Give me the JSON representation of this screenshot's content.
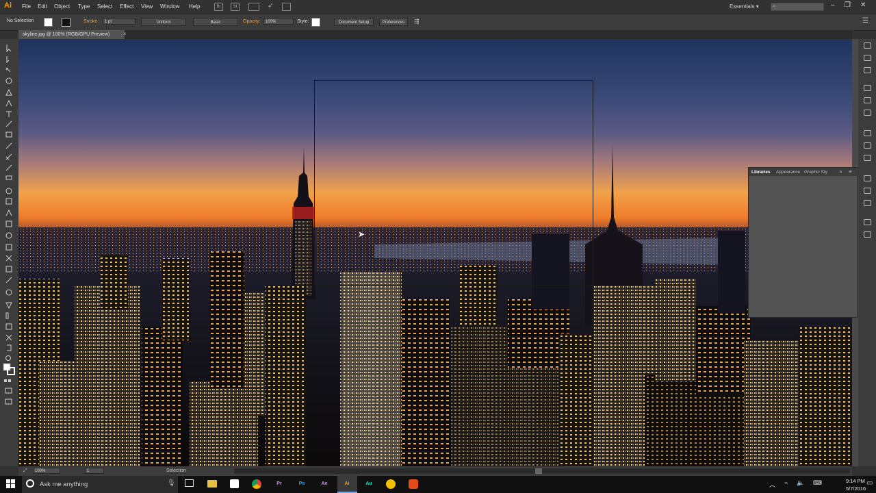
{
  "app": {
    "logo": "Ai",
    "menus": [
      "File",
      "Edit",
      "Object",
      "Type",
      "Select",
      "Effect",
      "View",
      "Window",
      "Help"
    ],
    "bridge_icons": [
      "Br",
      "St"
    ],
    "workspace": "Essentials",
    "window_controls": {
      "minimize": "–",
      "restore": "❐",
      "close": "✕"
    }
  },
  "control_bar": {
    "selection": "No Selection",
    "stroke_label": "Stroke:",
    "stroke_weight": "1 pt",
    "stroke_profile": "Uniform",
    "brush": "Basic",
    "opacity_label": "Opacity:",
    "opacity_value": "100%",
    "style_label": "Style:",
    "document_setup": "Document Setup",
    "preferences": "Preferences"
  },
  "document": {
    "tab_title": "skyline.jpg @ 100% (RGB/GPU Preview)",
    "close": "×"
  },
  "panel": {
    "tabs": [
      "Libraries",
      "Appearance",
      "Graphic Sty"
    ],
    "menu": "»"
  },
  "status_bar": {
    "zoom": "100%",
    "artboard": "1",
    "tool": "Selection"
  },
  "taskbar": {
    "search_placeholder": "Ask me anything",
    "apps": [
      {
        "label": "Pr",
        "color": "#2a0a3d",
        "text": "#d98cff"
      },
      {
        "label": "Ps",
        "color": "#0a1f33",
        "text": "#31a8ff"
      },
      {
        "label": "Ae",
        "color": "#1a0a33",
        "text": "#d291ff"
      },
      {
        "label": "Ai",
        "color": "#3a1c00",
        "text": "#ff9a00"
      },
      {
        "label": "Au",
        "color": "#003322",
        "text": "#00e4bb"
      }
    ],
    "time": "9:14 PM",
    "date": "5/7/2016"
  },
  "colors": {
    "ui_dark": "#323232",
    "ui_mid": "#3c3c3c",
    "accent": "#f7a000"
  }
}
